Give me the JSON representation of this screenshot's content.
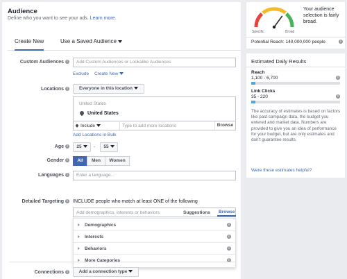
{
  "audience": {
    "title": "Audience",
    "subtitle": "Define who you want to see your ads.",
    "learn_more": "Learn more."
  },
  "tabs": [
    {
      "label": "Create New",
      "active": true
    },
    {
      "label": "Use a Saved Audience",
      "active": false
    }
  ],
  "custom_audiences": {
    "label": "Custom Audiences",
    "placeholder": "Add Custom Audiences or Lookalike Audiences",
    "exclude": "Exclude",
    "create_new": "Create New"
  },
  "locations": {
    "label": "Locations",
    "dropdown": "Everyone in this location",
    "country_header": "United States",
    "selected": "United States",
    "include": "Include",
    "placeholder": "Type to add more locations",
    "browse": "Browse",
    "bulk_link": "Add Locations in Bulk"
  },
  "age": {
    "label": "Age",
    "min": "25",
    "separator": "-",
    "max": "55"
  },
  "gender": {
    "label": "Gender",
    "options": [
      "All",
      "Men",
      "Women"
    ],
    "selected": "All"
  },
  "languages": {
    "label": "Languages",
    "placeholder": "Enter a language..."
  },
  "detailed_targeting": {
    "label": "Detailed Targeting",
    "include_text": "INCLUDE people who match at least ONE of the following",
    "placeholder": "Add demographics, interests or behaviors",
    "suggestions": "Suggestions",
    "browse": "Browse",
    "categories": [
      "Demographics",
      "Interests",
      "Behaviors",
      "More Categories"
    ]
  },
  "connections": {
    "label": "Connections",
    "button": "Add a connection type"
  },
  "audience_size": {
    "gauge_level": 0.7,
    "description": "Your audience selection is fairly broad.",
    "specific": "Specific",
    "broad": "Broad",
    "potential_reach": "Potential Reach: 140,000,000 people"
  },
  "estimated_results": {
    "title": "Estimated Daily Results",
    "reach_label": "Reach",
    "reach_value": "1,100 - 6,700",
    "reach_fill": 0.05,
    "clicks_label": "Link Clicks",
    "clicks_value": "35 - 220",
    "clicks_fill": 0.05,
    "disclaimer": "The accuracy of estimates is based on factors like past campaign data, the budget you entered and market data. Numbers are provided to give you an idea of performance for your budget, but are only estimates and don't guarantee results.",
    "helpful_link": "Were these estimates helpful?"
  },
  "colors": {
    "accent": "#4267b2",
    "gauge_red": "#e9423a",
    "gauge_yellow": "#f7b928",
    "gauge_green": "#44b35a",
    "bar_fill": "#4ea8de"
  }
}
